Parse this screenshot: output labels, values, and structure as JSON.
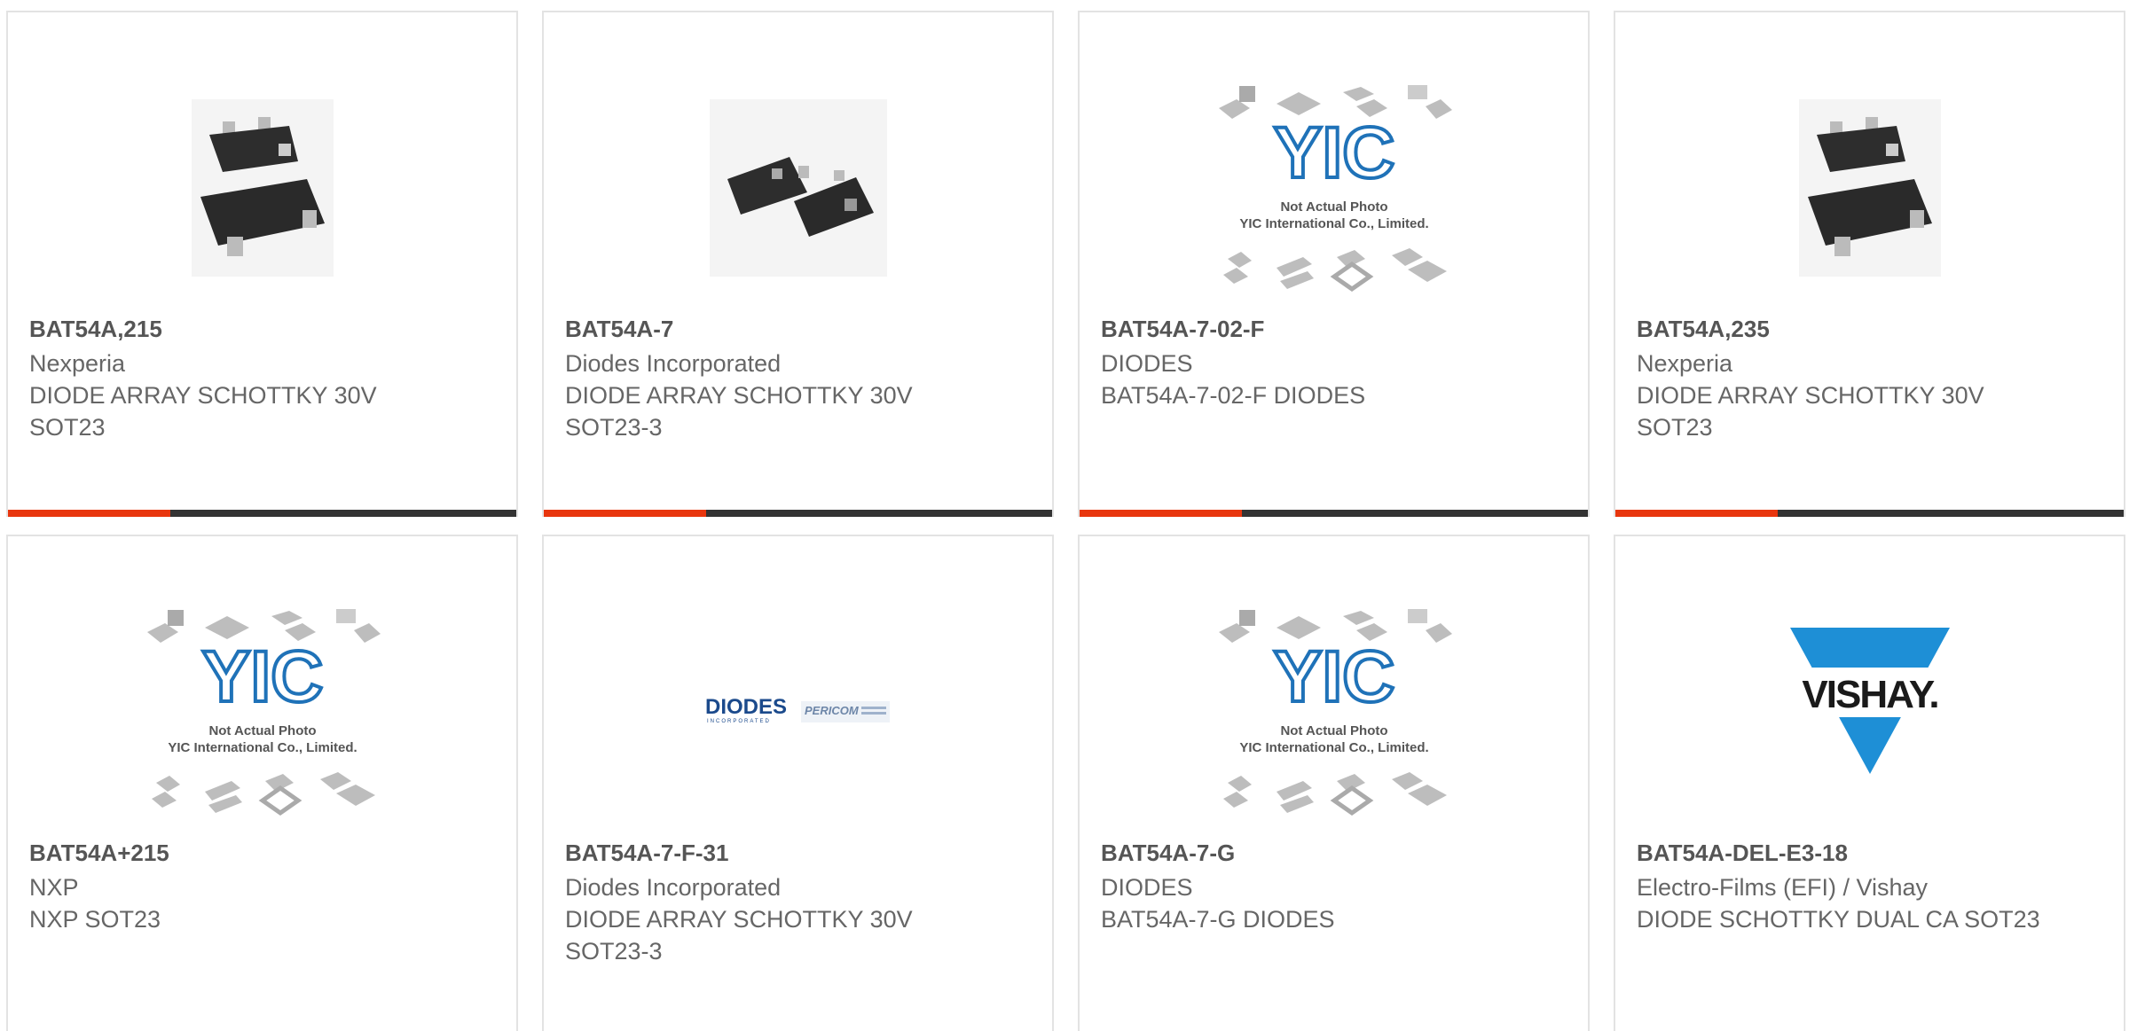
{
  "accent_colors": {
    "red": "#e8360e",
    "dark": "#333333"
  },
  "placeholder": {
    "brand": "YIC",
    "line1": "Not Actual Photo",
    "line2": "YIC International Co., Limited."
  },
  "logos": {
    "diodes": "DIODES",
    "diodes_sub": "INCORPORATED",
    "pericom": "PERICOM",
    "vishay": "VISHAY."
  },
  "products": [
    {
      "part_number": "BAT54A,215",
      "manufacturer": "Nexperia",
      "description": "DIODE ARRAY SCHOTTKY 30V SOT23",
      "image": "sot23-chip-icon"
    },
    {
      "part_number": "BAT54A-7",
      "manufacturer": "Diodes Incorporated",
      "description": "DIODE ARRAY SCHOTTKY 30V SOT23-3",
      "image": "sot23-pair-icon"
    },
    {
      "part_number": "BAT54A-7-02-F",
      "manufacturer": "DIODES",
      "description": "BAT54A-7-02-F DIODES",
      "image": "yic-placeholder-icon"
    },
    {
      "part_number": "BAT54A,235",
      "manufacturer": "Nexperia",
      "description": "DIODE ARRAY SCHOTTKY 30V SOT23",
      "image": "sot23-chip-icon"
    },
    {
      "part_number": "BAT54A+215",
      "manufacturer": "NXP",
      "description": "NXP SOT23",
      "image": "yic-placeholder-icon"
    },
    {
      "part_number": "BAT54A-7-F-31",
      "manufacturer": "Diodes Incorporated",
      "description": "DIODE ARRAY SCHOTTKY 30V SOT23-3",
      "image": "diodes-pericom-logo"
    },
    {
      "part_number": "BAT54A-7-G",
      "manufacturer": "DIODES",
      "description": "BAT54A-7-G DIODES",
      "image": "yic-placeholder-icon"
    },
    {
      "part_number": "BAT54A-DEL-E3-18",
      "manufacturer": "Electro-Films (EFI) / Vishay",
      "description": "DIODE SCHOTTKY DUAL CA SOT23",
      "image": "vishay-logo"
    }
  ]
}
